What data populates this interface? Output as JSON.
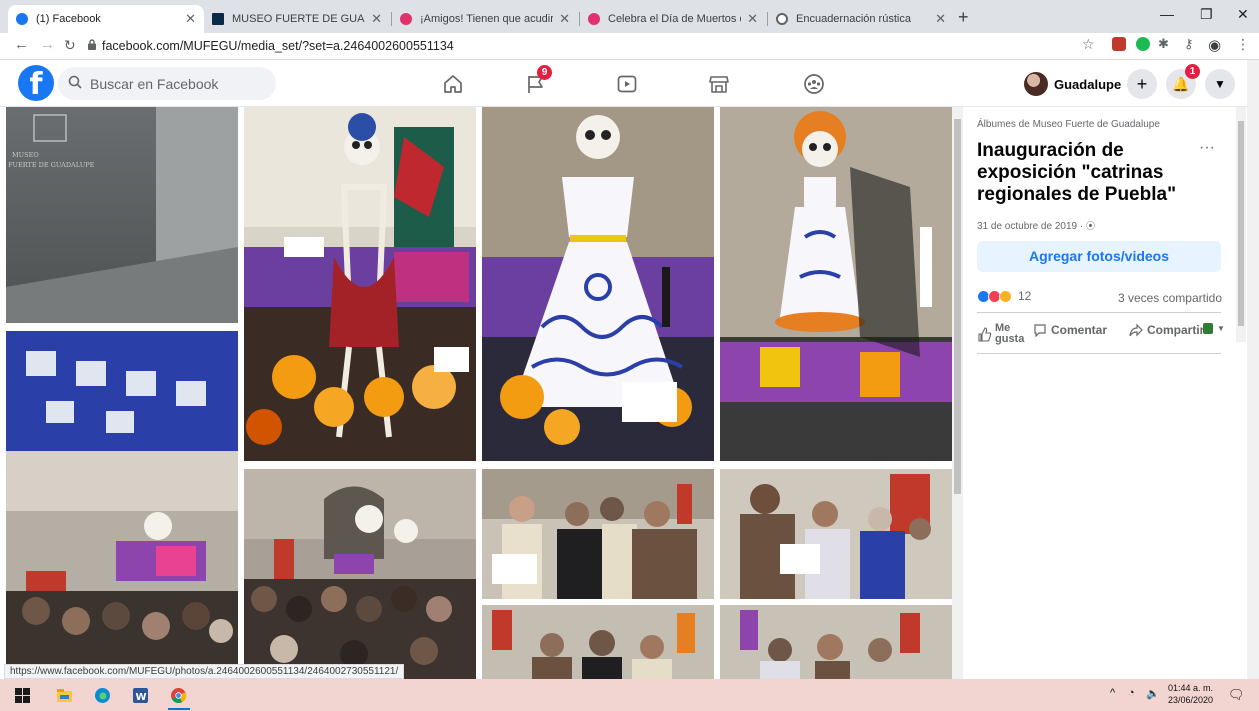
{
  "browser": {
    "tabs": [
      {
        "title": "(1) Facebook",
        "active": true,
        "favicon_color": "#1877f2"
      },
      {
        "title": "MUSEO FUERTE DE GUADALUPE",
        "active": false,
        "favicon_color": "#0b2a48"
      },
      {
        "title": "¡Amigos! Tienen que acudir a est",
        "active": false,
        "favicon_color": "#e1306c"
      },
      {
        "title": "Celebra el Día de Muertos con el",
        "active": false,
        "favicon_color": "#e1306c"
      },
      {
        "title": "Encuadernación rústica",
        "active": false,
        "favicon_color": "#5f6368"
      }
    ],
    "new_tab": "+",
    "url": "facebook.com/MUFEGU/media_set/?set=a.2464002600551134",
    "status_url": "https://www.facebook.com/MUFEGU/photos/a.2464002600551134/2464002730551121/"
  },
  "facebook": {
    "search_placeholder": "Buscar en Facebook",
    "groups_badge": "9",
    "notifications_badge": "1",
    "user_name": "Guadalupe",
    "accent": "#1877f2"
  },
  "album": {
    "breadcrumb": "Álbumes de Museo Fuerte de Guadalupe",
    "title": "Inauguración de exposición \"catrinas regionales de Puebla\"",
    "date": "31 de octubre de 2019 · ",
    "add_button": "Agregar fotos/videos",
    "reactions_count": "12",
    "shares": "3 veces compartido",
    "like_label": "Me gusta",
    "comment_label": "Comentar",
    "share_label": "Compartir",
    "more_label": "···"
  },
  "taskbar": {
    "time": "01:44 a. m.",
    "date": "23/06/2020"
  }
}
